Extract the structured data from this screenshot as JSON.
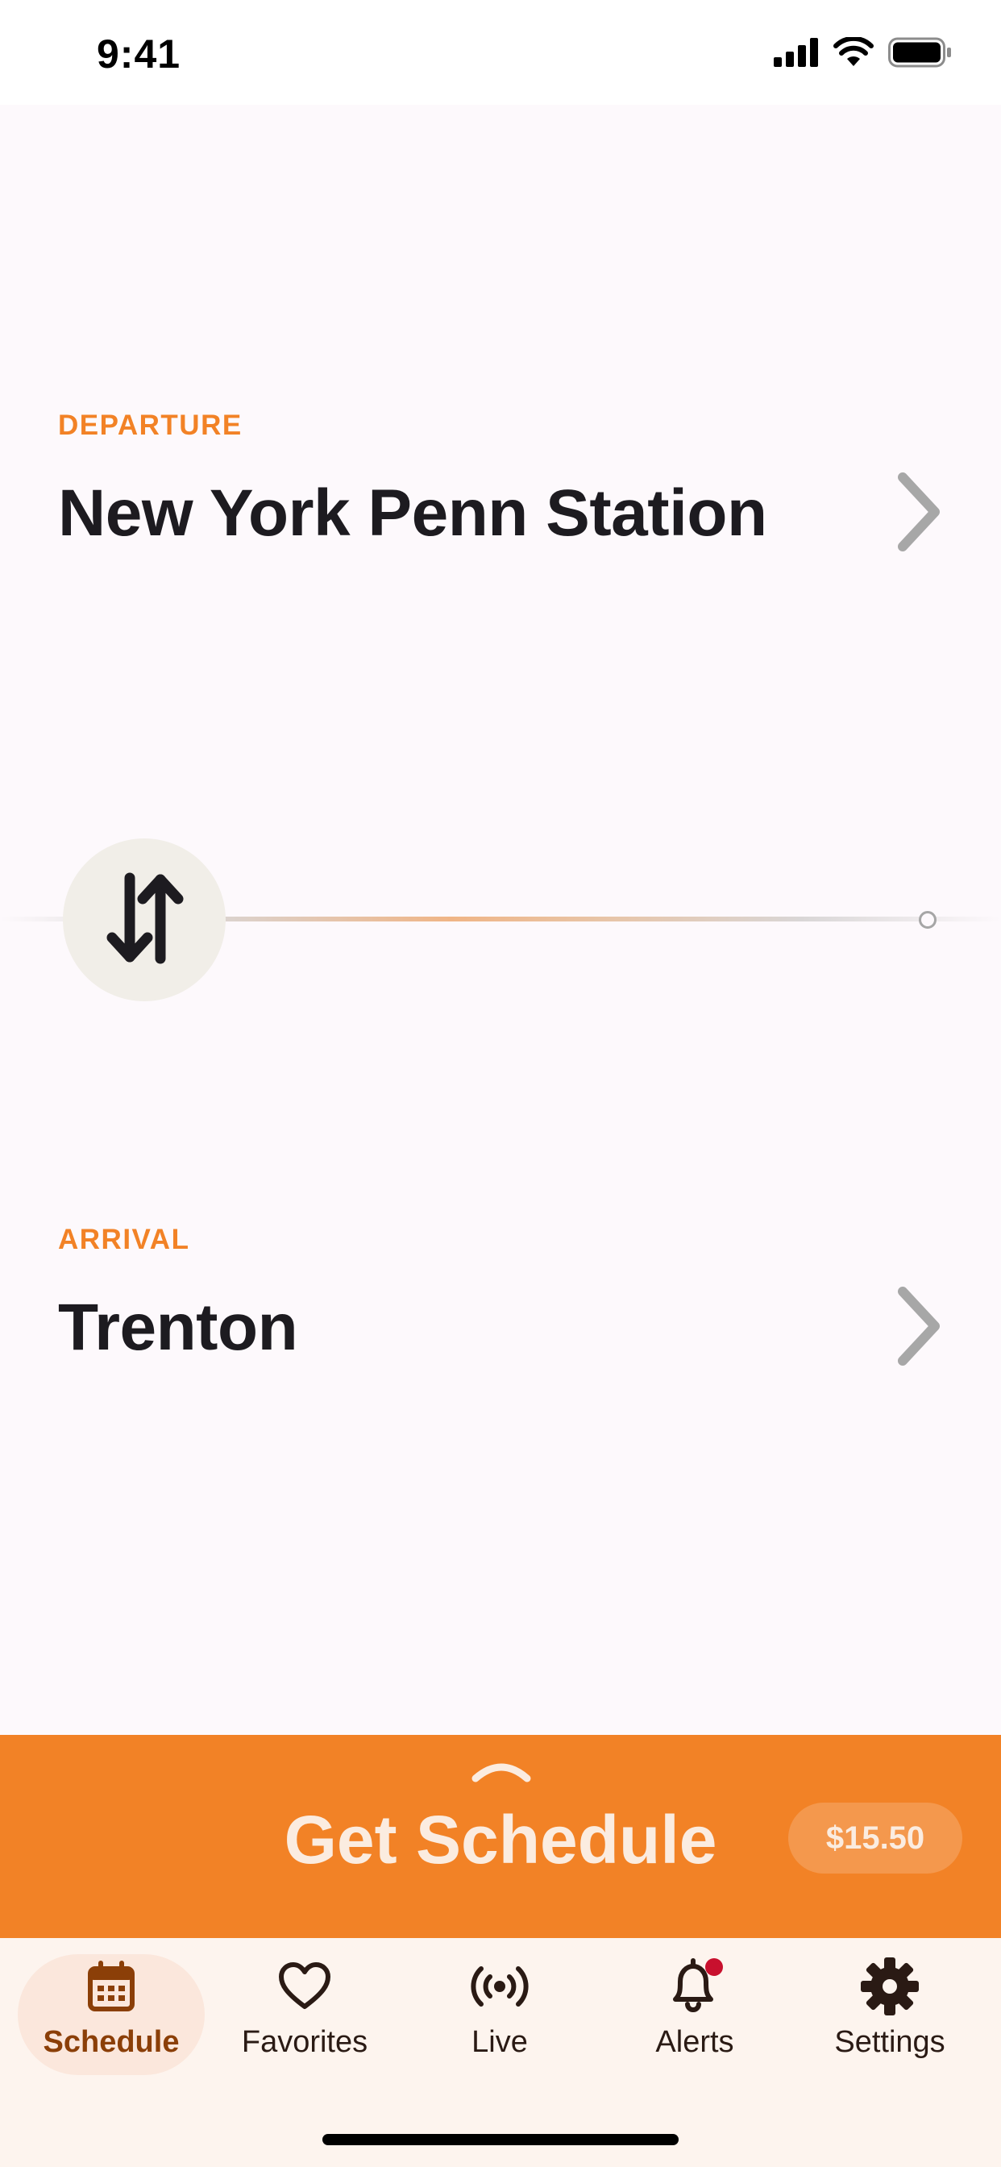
{
  "status_bar": {
    "time": "9:41",
    "icons": [
      "cellular-signal-icon",
      "wifi-icon",
      "battery-icon"
    ]
  },
  "departure": {
    "label": "DEPARTURE",
    "station": "New York Penn Station"
  },
  "arrival": {
    "label": "ARRIVAL",
    "station": "Trenton"
  },
  "swap_icon": "swap-vertical-icon",
  "cta": {
    "title": "Get Schedule",
    "price": "$15.50"
  },
  "tabs": [
    {
      "label": "Schedule",
      "icon": "calendar-icon",
      "active": true
    },
    {
      "label": "Favorites",
      "icon": "heart-icon",
      "active": false
    },
    {
      "label": "Live",
      "icon": "broadcast-icon",
      "active": false
    },
    {
      "label": "Alerts",
      "icon": "bell-icon",
      "active": false,
      "badge": true
    },
    {
      "label": "Settings",
      "icon": "gear-icon",
      "active": false
    }
  ],
  "colors": {
    "accent": "#f28226",
    "active_tab": "#8b3f08",
    "background": "#fdf9fc",
    "alert_badge": "#c8102e"
  }
}
